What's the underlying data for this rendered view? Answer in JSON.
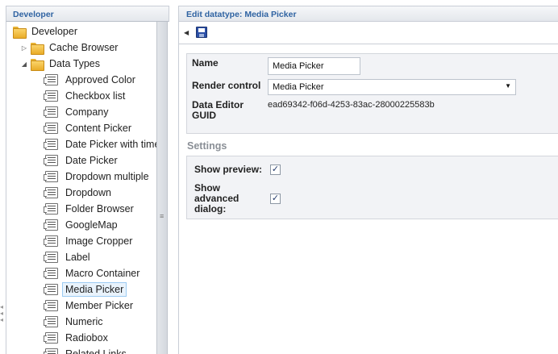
{
  "left_panel": {
    "title": "Developer",
    "tree": [
      {
        "label": "Developer",
        "type": "folder",
        "expander": ""
      },
      {
        "label": "Cache Browser",
        "type": "folder",
        "expander": "▷"
      },
      {
        "label": "Data Types",
        "type": "folder",
        "expander": "◢"
      },
      {
        "label": "Approved Color",
        "type": "datatype"
      },
      {
        "label": "Checkbox list",
        "type": "datatype"
      },
      {
        "label": "Company",
        "type": "datatype"
      },
      {
        "label": "Content Picker",
        "type": "datatype"
      },
      {
        "label": "Date Picker with time",
        "type": "datatype"
      },
      {
        "label": "Date Picker",
        "type": "datatype"
      },
      {
        "label": "Dropdown multiple",
        "type": "datatype"
      },
      {
        "label": "Dropdown",
        "type": "datatype"
      },
      {
        "label": "Folder Browser",
        "type": "datatype"
      },
      {
        "label": "GoogleMap",
        "type": "datatype"
      },
      {
        "label": "Image Cropper",
        "type": "datatype"
      },
      {
        "label": "Label",
        "type": "datatype"
      },
      {
        "label": "Macro Container",
        "type": "datatype"
      },
      {
        "label": "Media Picker",
        "type": "datatype",
        "selected": true
      },
      {
        "label": "Member Picker",
        "type": "datatype"
      },
      {
        "label": "Numeric",
        "type": "datatype"
      },
      {
        "label": "Radiobox",
        "type": "datatype"
      },
      {
        "label": "Related Links",
        "type": "datatype"
      }
    ]
  },
  "editor": {
    "title": "Edit datatype: Media Picker",
    "name_label": "Name",
    "name_value": "Media Picker",
    "render_control_label": "Render control",
    "render_control_value": "Media Picker",
    "guid_label_line1": "Data Editor",
    "guid_label_line2": "GUID",
    "guid_value": "ead69342-f06d-4253-83ac-28000225583b",
    "settings_title": "Settings",
    "show_preview_label": "Show preview:",
    "show_preview_checked": true,
    "show_advanced_line1": "Show",
    "show_advanced_line2": "advanced",
    "show_advanced_line3": "dialog:",
    "show_advanced_checked": true
  },
  "icons": {
    "folder": "folder-icon",
    "datatype": "datatype-icon",
    "save": "save-icon"
  },
  "colors": {
    "header_text": "#2f63a2",
    "selected_bg": "#e9f3fc",
    "selected_border": "#9ccbf2",
    "panel_bg": "#f2f3f6"
  }
}
